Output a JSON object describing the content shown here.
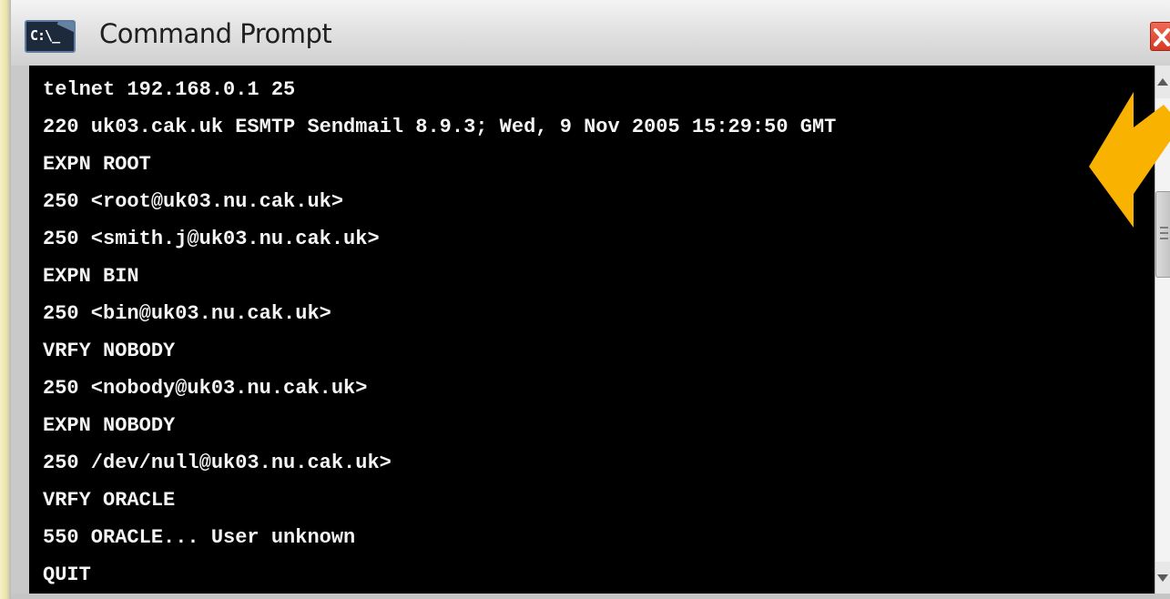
{
  "window": {
    "title": "Command Prompt",
    "icon_text": "C:\\_"
  },
  "console": {
    "lines": [
      "telnet 192.168.0.1 25",
      "220 uk03.cak.uk ESMTP Sendmail 8.9.3; Wed, 9 Nov 2005 15:29:50 GMT",
      "EXPN ROOT",
      "250 <root@uk03.nu.cak.uk>",
      "250 <smith.j@uk03.nu.cak.uk>",
      "EXPN BIN",
      "250 <bin@uk03.nu.cak.uk>",
      "VRFY NOBODY",
      "250 <nobody@uk03.nu.cak.uk>",
      "EXPN NOBODY",
      "250 /dev/null@uk03.nu.cak.uk>",
      "VRFY ORACLE",
      "550 ORACLE... User unknown",
      "QUIT"
    ]
  },
  "colors": {
    "console_bg": "#000000",
    "console_text": "#f4f4f4",
    "close_button": "#e04a33",
    "annotation_arrow": "#f9b200"
  },
  "icons": {
    "app": "cmd-icon",
    "close": "close-icon",
    "scroll_up": "scroll-up-icon",
    "scroll_down": "scroll-down-icon",
    "annotation": "annotation-arrow-icon"
  }
}
